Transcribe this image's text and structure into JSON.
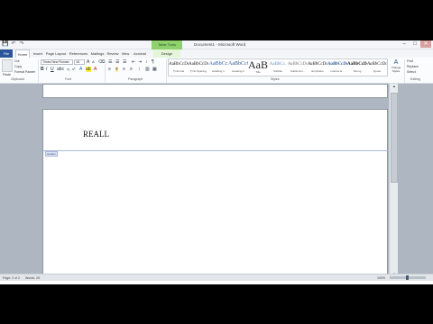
{
  "window": {
    "title": "Document1 - Microsoft Word",
    "context_tab": "Table Tools",
    "context_sub": "Design",
    "minimize": "–",
    "maximize": "□",
    "close": "✕"
  },
  "qat": {
    "save": "💾",
    "undo": "↶",
    "redo": "↷"
  },
  "tabs": [
    "File",
    "Home",
    "Insert",
    "Page Layout",
    "References",
    "Mailings",
    "Review",
    "View",
    "Acrobat"
  ],
  "ribbon": {
    "clipboard": {
      "paste": "Paste",
      "cut": "Cut",
      "copy": "Copy",
      "format_painter": "Format Painter",
      "label": "Clipboard"
    },
    "font": {
      "name": "Times New Roman",
      "size": "18",
      "label": "Font"
    },
    "paragraph": {
      "label": "Paragraph"
    },
    "styles": {
      "label": "Styles",
      "items": [
        {
          "preview": "AaBbCcDc",
          "name": "¶ Normal"
        },
        {
          "preview": "AaBbCcDc",
          "name": "¶ No Spacing"
        },
        {
          "preview": "AaBbCc",
          "name": "Heading 1"
        },
        {
          "preview": "AaBbCcC",
          "name": "Heading 2"
        },
        {
          "preview": "AaB",
          "name": "Title"
        },
        {
          "preview": "AaBbCc.",
          "name": "Subtitle"
        },
        {
          "preview": "AaBbCcDc",
          "name": "Subtle Em..."
        },
        {
          "preview": "AaBbCcDc",
          "name": "Emphasis"
        },
        {
          "preview": "AaBbCcDc",
          "name": "Intense E..."
        },
        {
          "preview": "AaBbCcDc",
          "name": "Strong"
        },
        {
          "preview": "AaBbCcDc",
          "name": "Quote"
        }
      ],
      "change": "Change Styles"
    },
    "editing": {
      "find": "Find",
      "replace": "Replace",
      "select": "Select",
      "label": "Editing"
    }
  },
  "document": {
    "text": "REALL",
    "header_label": "Header"
  },
  "status": {
    "page": "Page: 2 of 2",
    "words": "Words: 25",
    "zoom": "100%"
  }
}
